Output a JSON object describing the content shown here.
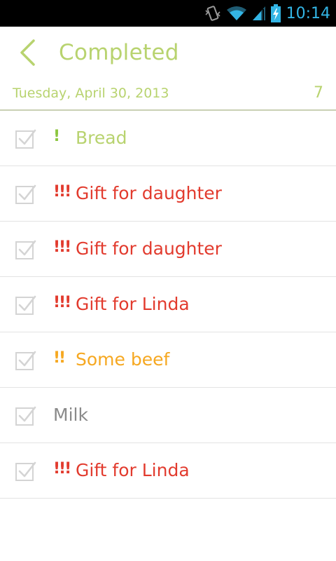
{
  "status_bar": {
    "time": "10:14",
    "icons": [
      "vibrate-icon",
      "wifi-icon",
      "signal-icon",
      "battery-charging-icon"
    ]
  },
  "header": {
    "title": "Completed",
    "back_icon": "back-chevron-icon"
  },
  "date_group": {
    "date": "Tuesday, April 30, 2013",
    "count": "7"
  },
  "colors": {
    "accent_green": "#b8d36f",
    "priority_low": "#8cc63f",
    "priority_medium": "#f6a821",
    "priority_high": "#e23b2e",
    "neutral_text": "#8a8a8a",
    "status_blue": "#33b5e5"
  },
  "tasks": [
    {
      "priority": "!",
      "label": "Bread",
      "level": "low"
    },
    {
      "priority": "!!!",
      "label": "Gift for daughter",
      "level": "high"
    },
    {
      "priority": "!!!",
      "label": "Gift for daughter",
      "level": "high"
    },
    {
      "priority": "!!!",
      "label": "Gift for Linda",
      "level": "high"
    },
    {
      "priority": "!!",
      "label": "Some beef",
      "level": "medium"
    },
    {
      "priority": "",
      "label": "Milk",
      "level": "none"
    },
    {
      "priority": "!!!",
      "label": "Gift for Linda",
      "level": "high"
    }
  ]
}
